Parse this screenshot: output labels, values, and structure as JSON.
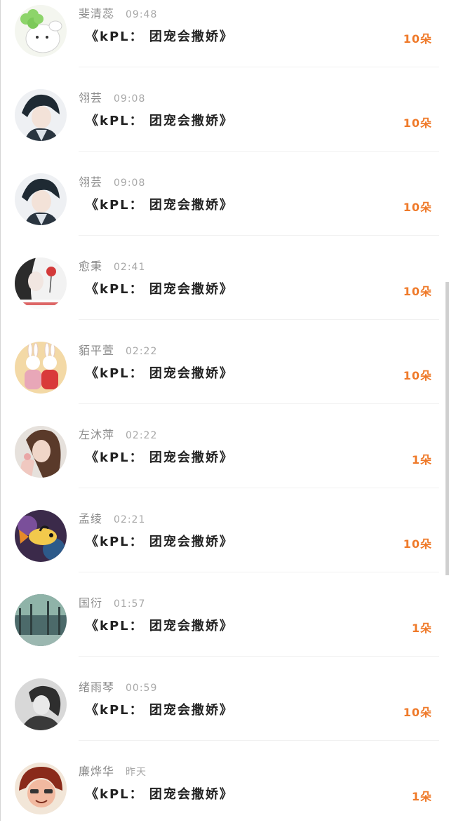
{
  "message_list": {
    "items": [
      {
        "name": "斐清蕊",
        "time": "09:48",
        "message": "《kPL： 团宠会撒娇》",
        "gift": "10朵",
        "avatar_icon": "cartoon-bear-clover-avatar"
      },
      {
        "name": "翎芸",
        "time": "09:08",
        "message": "《kPL： 团宠会撒娇》",
        "gift": "10朵",
        "avatar_icon": "anime-boy-avatar"
      },
      {
        "name": "翎芸",
        "time": "09:08",
        "message": "《kPL： 团宠会撒娇》",
        "gift": "10朵",
        "avatar_icon": "anime-boy-avatar"
      },
      {
        "name": "愈秉",
        "time": "02:41",
        "message": "《kPL： 团宠会撒娇》",
        "gift": "10朵",
        "avatar_icon": "girl-with-flower-avatar"
      },
      {
        "name": "貊平萱",
        "time": "02:22",
        "message": "《kPL： 团宠会撒娇》",
        "gift": "10朵",
        "avatar_icon": "bunny-dolls-avatar"
      },
      {
        "name": "左沐萍",
        "time": "02:22",
        "message": "《kPL： 团宠会撒娇》",
        "gift": "1朵",
        "avatar_icon": "woman-portrait-avatar"
      },
      {
        "name": "孟绫",
        "time": "02:21",
        "message": "《kPL： 团宠会撒娇》",
        "gift": "10朵",
        "avatar_icon": "colorful-fish-avatar"
      },
      {
        "name": "国衍",
        "time": "01:57",
        "message": "《kPL： 团宠会撒娇》",
        "gift": "1朵",
        "avatar_icon": "rainy-street-avatar"
      },
      {
        "name": "绪雨琴",
        "time": "00:59",
        "message": "《kPL： 团宠会撒娇》",
        "gift": "10朵",
        "avatar_icon": "bw-woman-avatar"
      },
      {
        "name": "廉烨华",
        "time": "昨天",
        "message": "《kPL： 团宠会撒娇》",
        "gift": "1朵",
        "avatar_icon": "cartoon-red-hair-avatar"
      }
    ]
  },
  "colors": {
    "gift_accent": "#ef7a2a",
    "name_text": "#8a8a8a",
    "time_text": "#a8a8a8",
    "message_text": "#222222"
  }
}
